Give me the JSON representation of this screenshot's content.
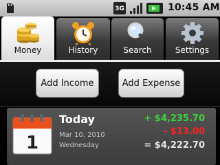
{
  "status_bar": {
    "network_label": "3G",
    "time": "10:45 AM"
  },
  "tabs": [
    {
      "label": "Money",
      "icon": "coins-icon",
      "active": true
    },
    {
      "label": "History",
      "icon": "alarm-clock-icon",
      "active": false
    },
    {
      "label": "Search",
      "icon": "magnifier-icon",
      "active": false
    },
    {
      "label": "Settings",
      "icon": "gear-icon",
      "active": false
    }
  ],
  "actions": {
    "add_income": "Add Income",
    "add_expense": "Add Expense"
  },
  "summary": {
    "title": "Today",
    "date": "Mar 10, 2010",
    "weekday": "Wednesday",
    "calendar_day": "1",
    "income": "+ $4,235.70",
    "expense": "- $13.00",
    "balance": "= $4,222.70"
  },
  "colors": {
    "income": "#3bd23b",
    "expense": "#ff2222",
    "calendar_header": "#e8501c"
  }
}
